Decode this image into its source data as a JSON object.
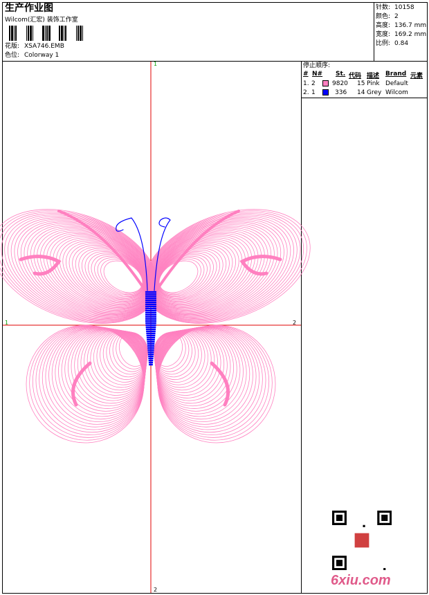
{
  "header": {
    "title": "生产作业图",
    "company": "Wilcom(汇宏) 装饰工作室",
    "design_label": "花版:",
    "design_value": "XSA746.EMB",
    "colorway_label": "色位:",
    "colorway_value": "Colorway 1"
  },
  "stats": [
    {
      "label": "针数:",
      "value": "10158"
    },
    {
      "label": "颜色:",
      "value": "2"
    },
    {
      "label": "高度:",
      "value": "136.7 mm"
    },
    {
      "label": "宽度:",
      "value": "169.2 mm"
    },
    {
      "label": "比例:",
      "value": "0.84"
    }
  ],
  "stop_sequence": {
    "title": "停止顺序:",
    "columns": [
      "#",
      "N#",
      "St.",
      "代码",
      "描述",
      "Brand",
      "元素"
    ],
    "rows": [
      {
        "idx": "1.",
        "n": "2",
        "color": "#ff80c0",
        "st": "9820",
        "code": "15",
        "desc": "Pink",
        "brand": "Default"
      },
      {
        "idx": "2.",
        "n": "1",
        "color": "#0000ff",
        "st": "336",
        "code": "14",
        "desc": "Grey",
        "brand": "Wilcom"
      }
    ]
  },
  "axis_labels": {
    "top": "1",
    "bottom": "2",
    "left": "1",
    "right": "2"
  },
  "colors": {
    "pink": "#ff80c0",
    "blue": "#0000ff",
    "axis": "#e00000"
  },
  "watermark": {
    "site": "6xiu.com",
    "qr_icon": "qr-code-icon"
  }
}
